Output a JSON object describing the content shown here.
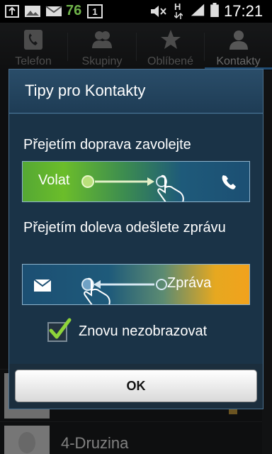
{
  "status_bar": {
    "notification_count": "76",
    "notification_small": "1",
    "network_type": "H",
    "time": "17:21",
    "icons": [
      "usb-icon",
      "image-icon",
      "mail-icon",
      "counter-icon",
      "mute-icon",
      "signal-icon",
      "battery-icon"
    ]
  },
  "tabs": [
    {
      "label": "Telefon",
      "icon": "phone-icon"
    },
    {
      "label": "Skupiny",
      "icon": "group-icon"
    },
    {
      "label": "Oblíbené",
      "icon": "star-icon"
    },
    {
      "label": "Kontakty",
      "icon": "person-icon"
    }
  ],
  "background": {
    "visible_contact": "4-Druzina"
  },
  "dialog": {
    "title": "Tipy pro Kontakty",
    "tip_call": "Přejetím doprava zavolejte",
    "call_banner_label": "Volat",
    "tip_message": "Přejetím doleva odešlete zprávu",
    "message_banner_label": "Zpráva",
    "checkbox_label": "Znovu nezobrazovat",
    "checkbox_checked": true,
    "ok_label": "OK",
    "colors": {
      "call_green": "#6bbd2a",
      "message_orange": "#f2a21c",
      "dialog_blue": "#1d3b52",
      "check_green": "#8ed43a"
    }
  }
}
